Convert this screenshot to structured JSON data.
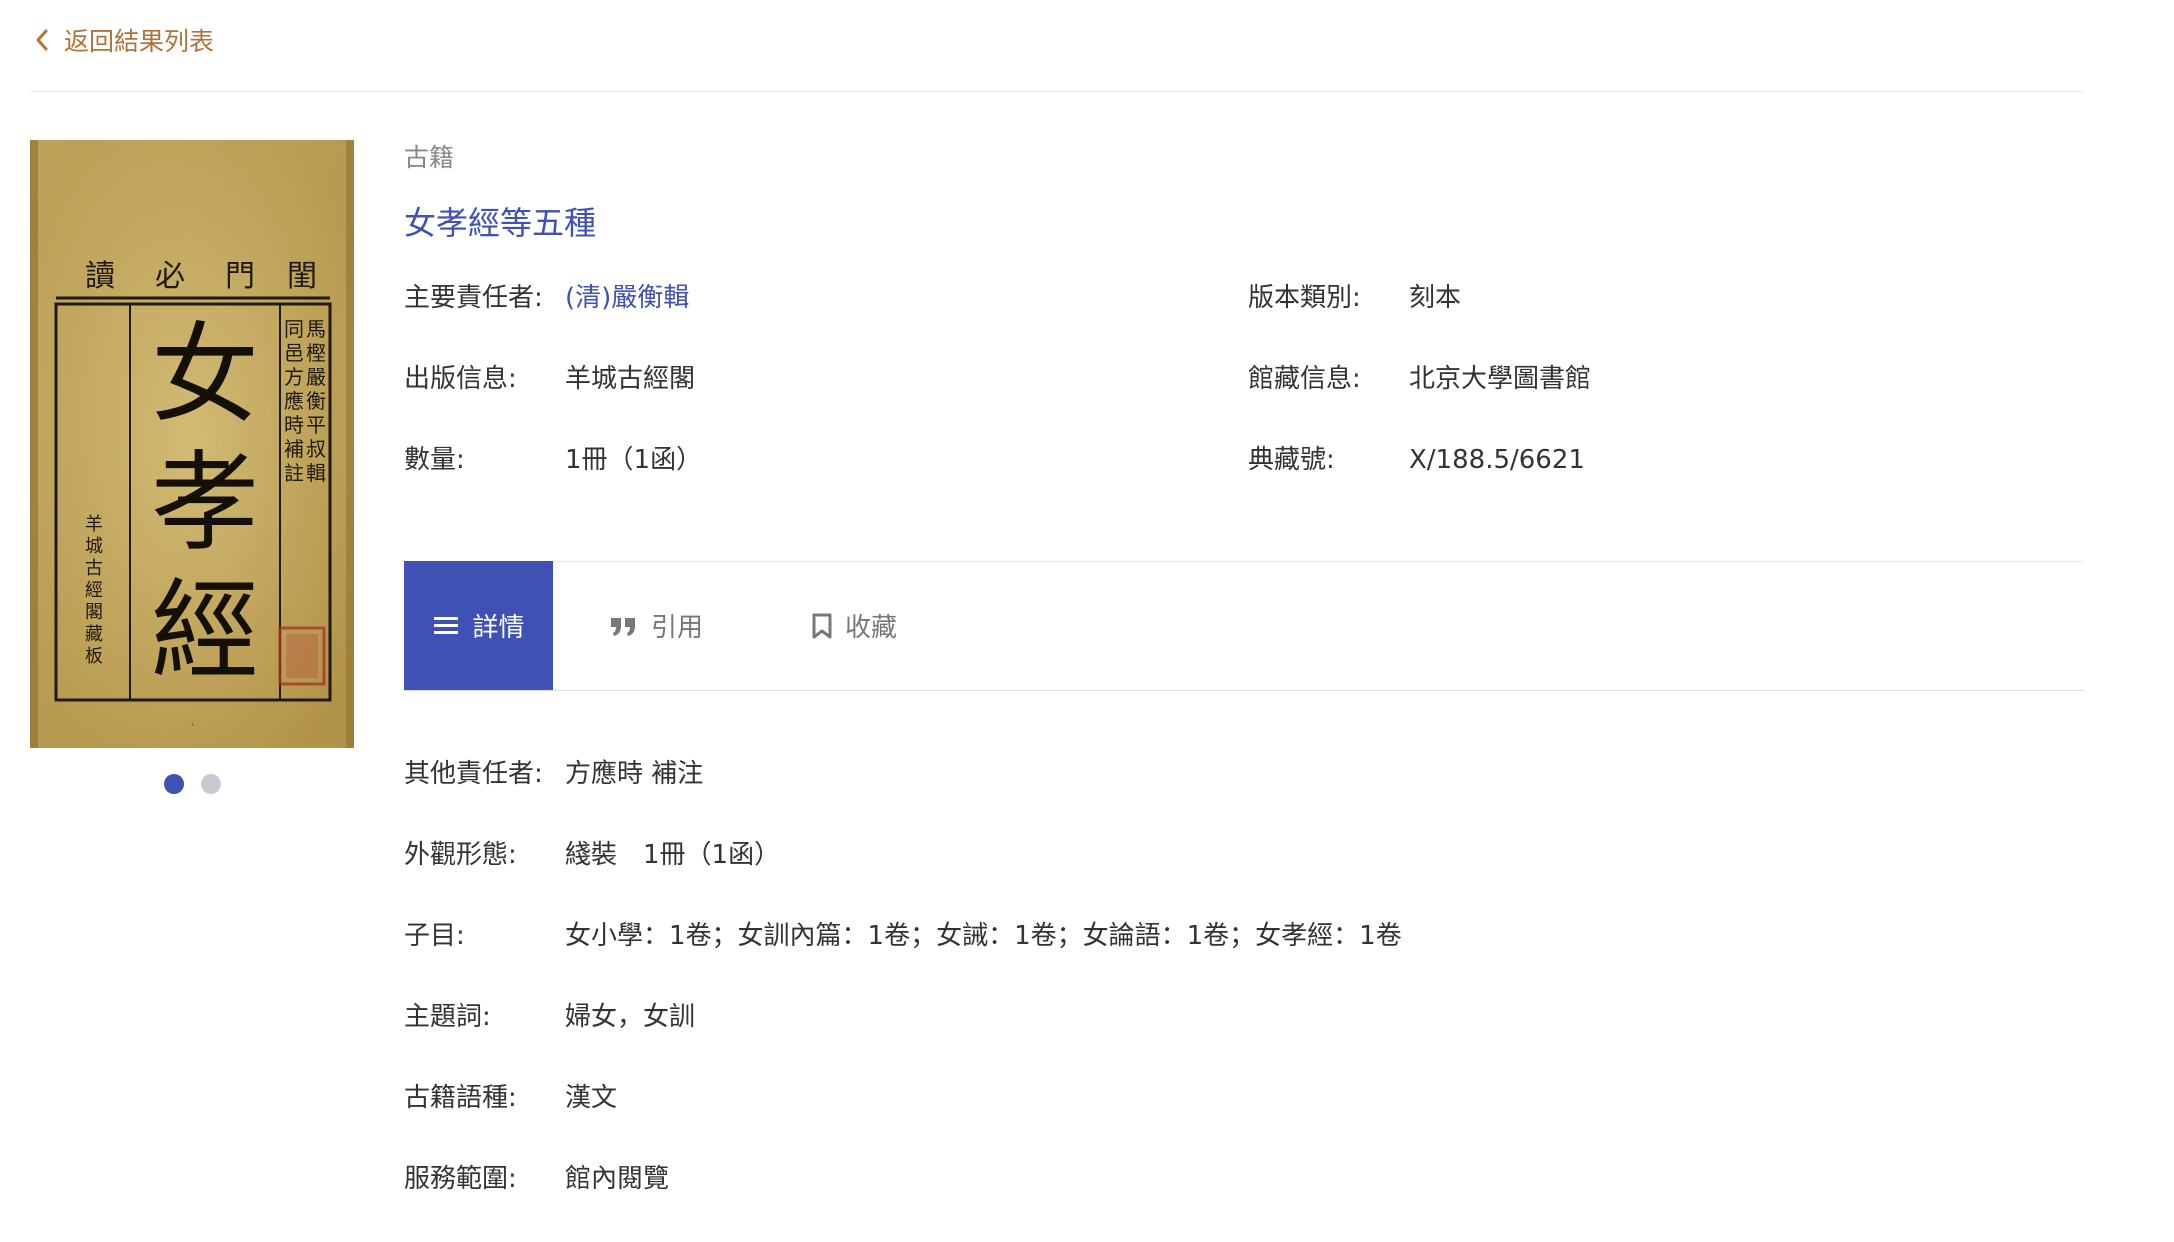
{
  "nav": {
    "back_label": "返回結果列表",
    "back_icon": "chevron-left-icon"
  },
  "colors": {
    "accent": "#3f51b5",
    "back_link": "#b2733a",
    "divider": "#ebebeb"
  },
  "carousel": {
    "image_alt": "女孝經 古籍書影",
    "cover_text": {
      "top_header": [
        "閨",
        "門",
        "必",
        "讀"
      ],
      "main_title": [
        "女",
        "孝",
        "經"
      ],
      "right_column_1": [
        "馬",
        "樫",
        "嚴",
        "衡",
        "平",
        "叔",
        "輯"
      ],
      "right_column_2": [
        "同",
        "邑",
        "方",
        "應",
        "時",
        "補",
        "註"
      ],
      "left_column": [
        "羊",
        "城",
        "古",
        "經",
        "閣",
        "藏",
        "板"
      ]
    },
    "total_slides": 2,
    "active_slide": 1
  },
  "record": {
    "category": "古籍",
    "title": "女孝經等五種",
    "meta": {
      "author_label": "主要責任者:",
      "author_value": "(清)嚴衡輯",
      "edition_label": "版本類別:",
      "edition_value": "刻本",
      "publisher_label": "出版信息:",
      "publisher_value": "羊城古經閣",
      "holding_label": "館藏信息:",
      "holding_value": "北京大學圖書館",
      "quantity_label": "數量:",
      "quantity_value": "1冊（1函）",
      "callno_label": "典藏號:",
      "callno_value": "X/188.5/6621"
    }
  },
  "tabs": [
    {
      "label": "詳情",
      "icon": "list-icon",
      "active": true
    },
    {
      "label": "引用",
      "icon": "quote-icon",
      "active": false
    },
    {
      "label": "收藏",
      "icon": "bookmark-icon",
      "active": false
    }
  ],
  "details": [
    {
      "label": "其他責任者:",
      "value": "方應時 補注"
    },
    {
      "label": "外觀形態:",
      "value": "綫裝　1冊（1函）"
    },
    {
      "label": "子目:",
      "value": "女小學：1卷；女訓內篇：1卷；女誡：1卷；女論語：1卷；女孝經：1卷"
    },
    {
      "label": "主題詞:",
      "value": "婦女，女訓"
    },
    {
      "label": "古籍語種:",
      "value": "漢文"
    },
    {
      "label": "服務範圍:",
      "value": "館內閱覽"
    }
  ]
}
